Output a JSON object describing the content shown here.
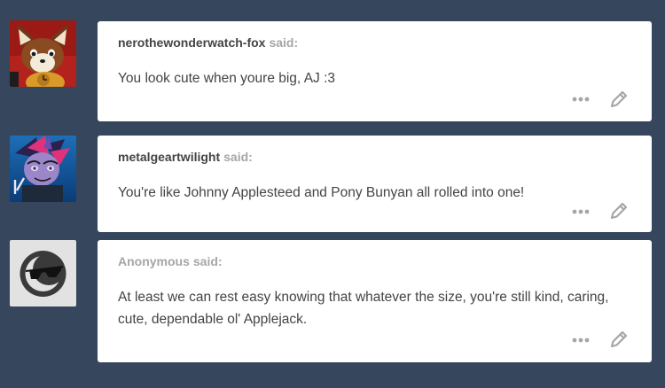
{
  "colors": {
    "dashboard_bg": "#36465d",
    "card_bg": "#ffffff",
    "text": "#444444",
    "muted": "#a6a6a6",
    "icon": "#a6a6a6"
  },
  "asks": [
    {
      "asker": "nerothewonderwatch-fox",
      "said": "said:",
      "question": "You look cute when youre big, AJ :3",
      "avatar_icon": "fox-avatar-icon"
    },
    {
      "asker": "metalgeartwilight",
      "said": "said:",
      "question": "You're like Johnny Applesteed and Pony Bunyan all rolled into one!",
      "avatar_icon": "pony-avatar-icon"
    },
    {
      "asker": "Anonymous",
      "said": "said:",
      "question": "At least we can rest easy knowing that whatever the size, you're still kind, caring, cute, dependable ol' Applejack.",
      "avatar_icon": "anonymous-sunglasses-avatar-icon"
    }
  ],
  "icons": {
    "more": "more-options-icon",
    "edit": "pencil-edit-icon"
  }
}
